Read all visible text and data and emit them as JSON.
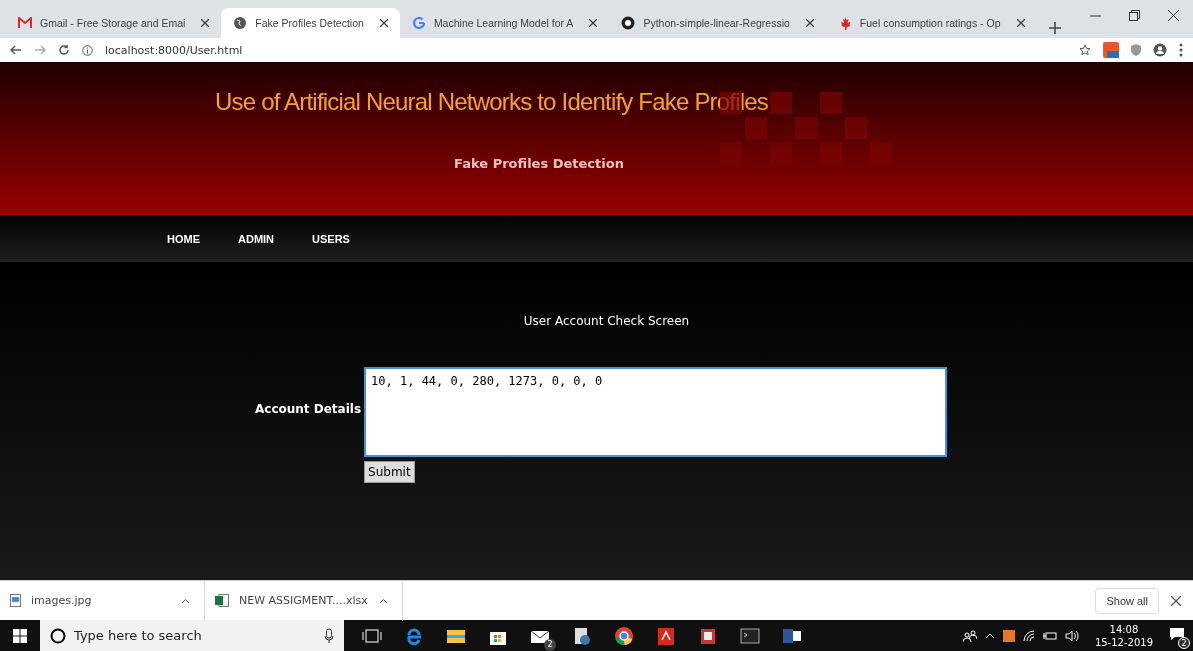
{
  "browser": {
    "tabs": [
      {
        "title": "Gmail - Free Storage and Emai",
        "selected": false
      },
      {
        "title": "Fake Profiles Detection",
        "selected": true
      },
      {
        "title": "Machine Learning Model for A",
        "selected": false
      },
      {
        "title": "Python-simple-linear-Regressio",
        "selected": false
      },
      {
        "title": "Fuel consumption ratings - Op",
        "selected": false
      }
    ],
    "url": "localhost:8000/User.html"
  },
  "page": {
    "title": "Use of Artificial Neural Networks to Identify Fake Profiles",
    "subtitle": "Fake Profiles Detection",
    "nav": [
      {
        "label": "HOME"
      },
      {
        "label": "ADMIN"
      },
      {
        "label": "USERS"
      }
    ],
    "form": {
      "heading": "User Account Check Screen",
      "label": "Account Details",
      "value": "10, 1, 44, 0, 280, 1273, 0, 0, 0",
      "submit": "Submit"
    }
  },
  "downloads": {
    "items": [
      {
        "name": "images.jpg",
        "kind": "image"
      },
      {
        "name": "NEW ASSIGMENT....xlsx",
        "kind": "sheet"
      }
    ],
    "show_all": "Show all"
  },
  "taskbar": {
    "search_placeholder": "Type here to search",
    "mail_badge": "2",
    "time": "14:08",
    "date": "15-12-2019",
    "notifications": "2"
  }
}
